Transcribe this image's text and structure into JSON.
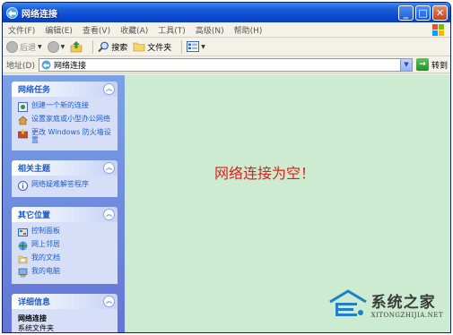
{
  "window": {
    "title": "网络连接"
  },
  "menu": [
    "文件(F)",
    "编辑(E)",
    "查看(V)",
    "收藏(A)",
    "工具(T)",
    "高级(N)",
    "帮助(H)"
  ],
  "toolbar": {
    "back": "后退",
    "search": "搜索",
    "folders": "文件夹"
  },
  "address": {
    "label": "地址(D)",
    "value": "网络连接",
    "go": "转到"
  },
  "taskpane": {
    "network_tasks": {
      "title": "网络任务",
      "items": [
        {
          "label": "创建一个新的连接",
          "icon": "new-connection-icon"
        },
        {
          "label": "设置家庭或小型办公网络",
          "icon": "home-network-icon"
        },
        {
          "label": "更改 Windows 防火墙设置",
          "icon": "firewall-icon"
        }
      ]
    },
    "related": {
      "title": "相关主题",
      "items": [
        {
          "label": "网络疑难解答程序",
          "icon": "info-icon"
        }
      ]
    },
    "other_places": {
      "title": "其它位置",
      "items": [
        {
          "label": "控制面板",
          "icon": "control-panel-icon"
        },
        {
          "label": "网上邻居",
          "icon": "network-places-icon"
        },
        {
          "label": "我的文档",
          "icon": "my-documents-icon"
        },
        {
          "label": "我的电脑",
          "icon": "my-computer-icon"
        }
      ]
    },
    "details": {
      "title": "详细信息",
      "name": "网络连接",
      "type": "系统文件夹"
    }
  },
  "main": {
    "empty_message": "网络连接为空！"
  },
  "watermark": {
    "title": "系统之家",
    "url": "XITONGZHIJIA.NET"
  },
  "colors": {
    "titlebar": "#0a4ad0",
    "taskpane": "#7ba2e7",
    "main_bg": "#ccebd0",
    "message": "#e0201a",
    "link": "#215dc6"
  }
}
